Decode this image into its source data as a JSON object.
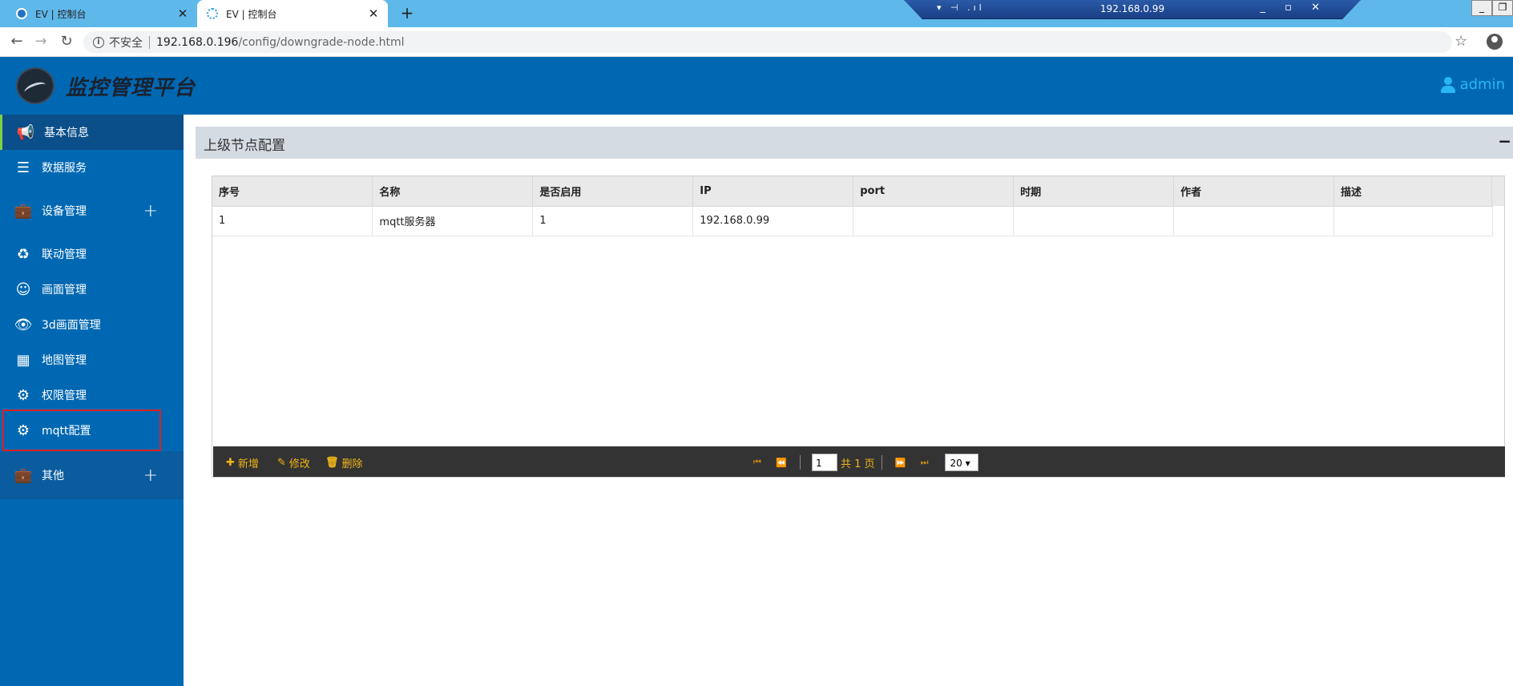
{
  "browser": {
    "tabs": [
      {
        "label": "EV | 控制台",
        "close": "✕"
      },
      {
        "label": "EV | 控制台",
        "close": "✕"
      }
    ],
    "new_tab": "+",
    "remote_ip": "192.168.0.99",
    "url_insecure_label": "不安全",
    "url_host": "192.168.0.196",
    "url_path": "/config/downgrade-node.html"
  },
  "app": {
    "title": "监控管理平台",
    "user": "admin"
  },
  "sidebar": {
    "items": [
      {
        "label": "基本信息",
        "icon": "bullhorn-icon"
      },
      {
        "label": "数据服务",
        "icon": "server-icon"
      },
      {
        "label": "设备管理",
        "icon": "briefcase-icon",
        "expand": "+"
      },
      {
        "label": "联动管理",
        "icon": "recycle-icon"
      },
      {
        "label": "画面管理",
        "icon": "smile-icon"
      },
      {
        "label": "3d画面管理",
        "icon": "eye-icon"
      },
      {
        "label": "地图管理",
        "icon": "calendar-icon"
      },
      {
        "label": "权限管理",
        "icon": "gear-icon"
      },
      {
        "label": "mqtt配置",
        "icon": "gear-icon"
      },
      {
        "label": "其他",
        "icon": "briefcase-icon",
        "expand": "+"
      }
    ]
  },
  "panel": {
    "title": "上级节点配置",
    "collapse": "−"
  },
  "table": {
    "columns": [
      "序号",
      "名称",
      "是否启用",
      "IP",
      "port",
      "时期",
      "作者",
      "描述"
    ],
    "rows": [
      [
        "1",
        "mqtt服务器",
        "1",
        "192.168.0.99",
        "",
        "",
        "",
        ""
      ]
    ]
  },
  "toolbar": {
    "add": "新增",
    "edit": "修改",
    "delete": "删除",
    "page_value": "1",
    "total_text": "共 1 页",
    "page_size": "20 ▾"
  }
}
